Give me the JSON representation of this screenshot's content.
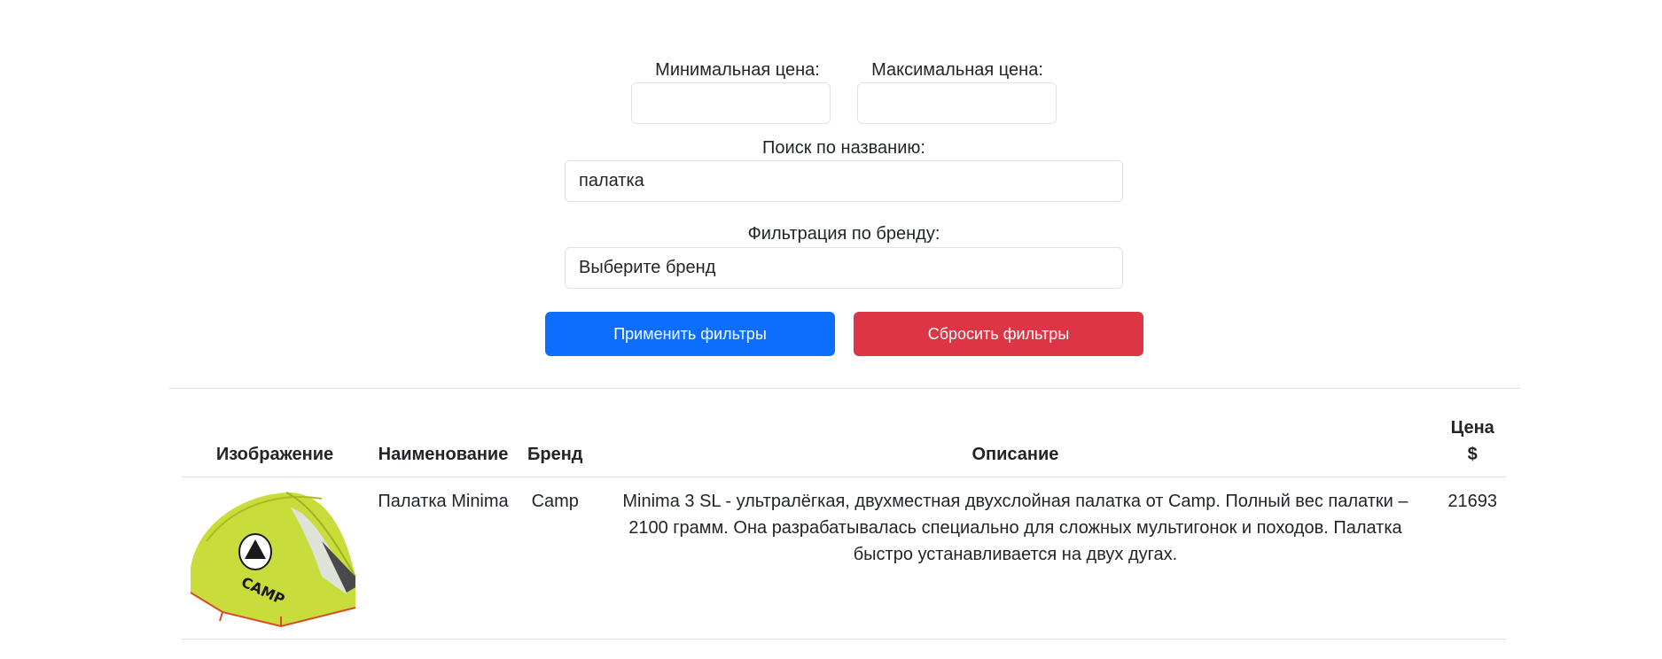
{
  "filters": {
    "min_price_label": "Минимальная цена:",
    "min_price_value": "",
    "max_price_label": "Максимальная цена:",
    "max_price_value": "",
    "search_label": "Поиск по названию:",
    "search_value": "палатка",
    "brand_label": "Фильтрация по бренду:",
    "brand_selected": "Выберите бренд",
    "apply_label": "Применить фильтры",
    "reset_label": "Сбросить фильтры"
  },
  "colors": {
    "primary": "#0d6efd",
    "danger": "#dc3545",
    "border": "#dee2e6",
    "tent_body": "#c8dc3c"
  },
  "table": {
    "headers": {
      "image": "Изображение",
      "name": "Наименование",
      "brand": "Бренд",
      "description": "Описание",
      "price_line1": "Цена",
      "price_line2": "$"
    },
    "rows": [
      {
        "image_icon": "tent-product-image",
        "image_logo_text": "CAMP",
        "name": "Палатка Minima",
        "brand": "Camp",
        "description": "Minima 3 SL - ультралёгкая, двухместная двухслойная палатка от Camp. Полный вес палатки – 2100 грамм. Она разрабатывалась специально для сложных мультигонок и походов. Палатка быстро устанавливается на двух дугах.",
        "price": "21693"
      }
    ]
  }
}
